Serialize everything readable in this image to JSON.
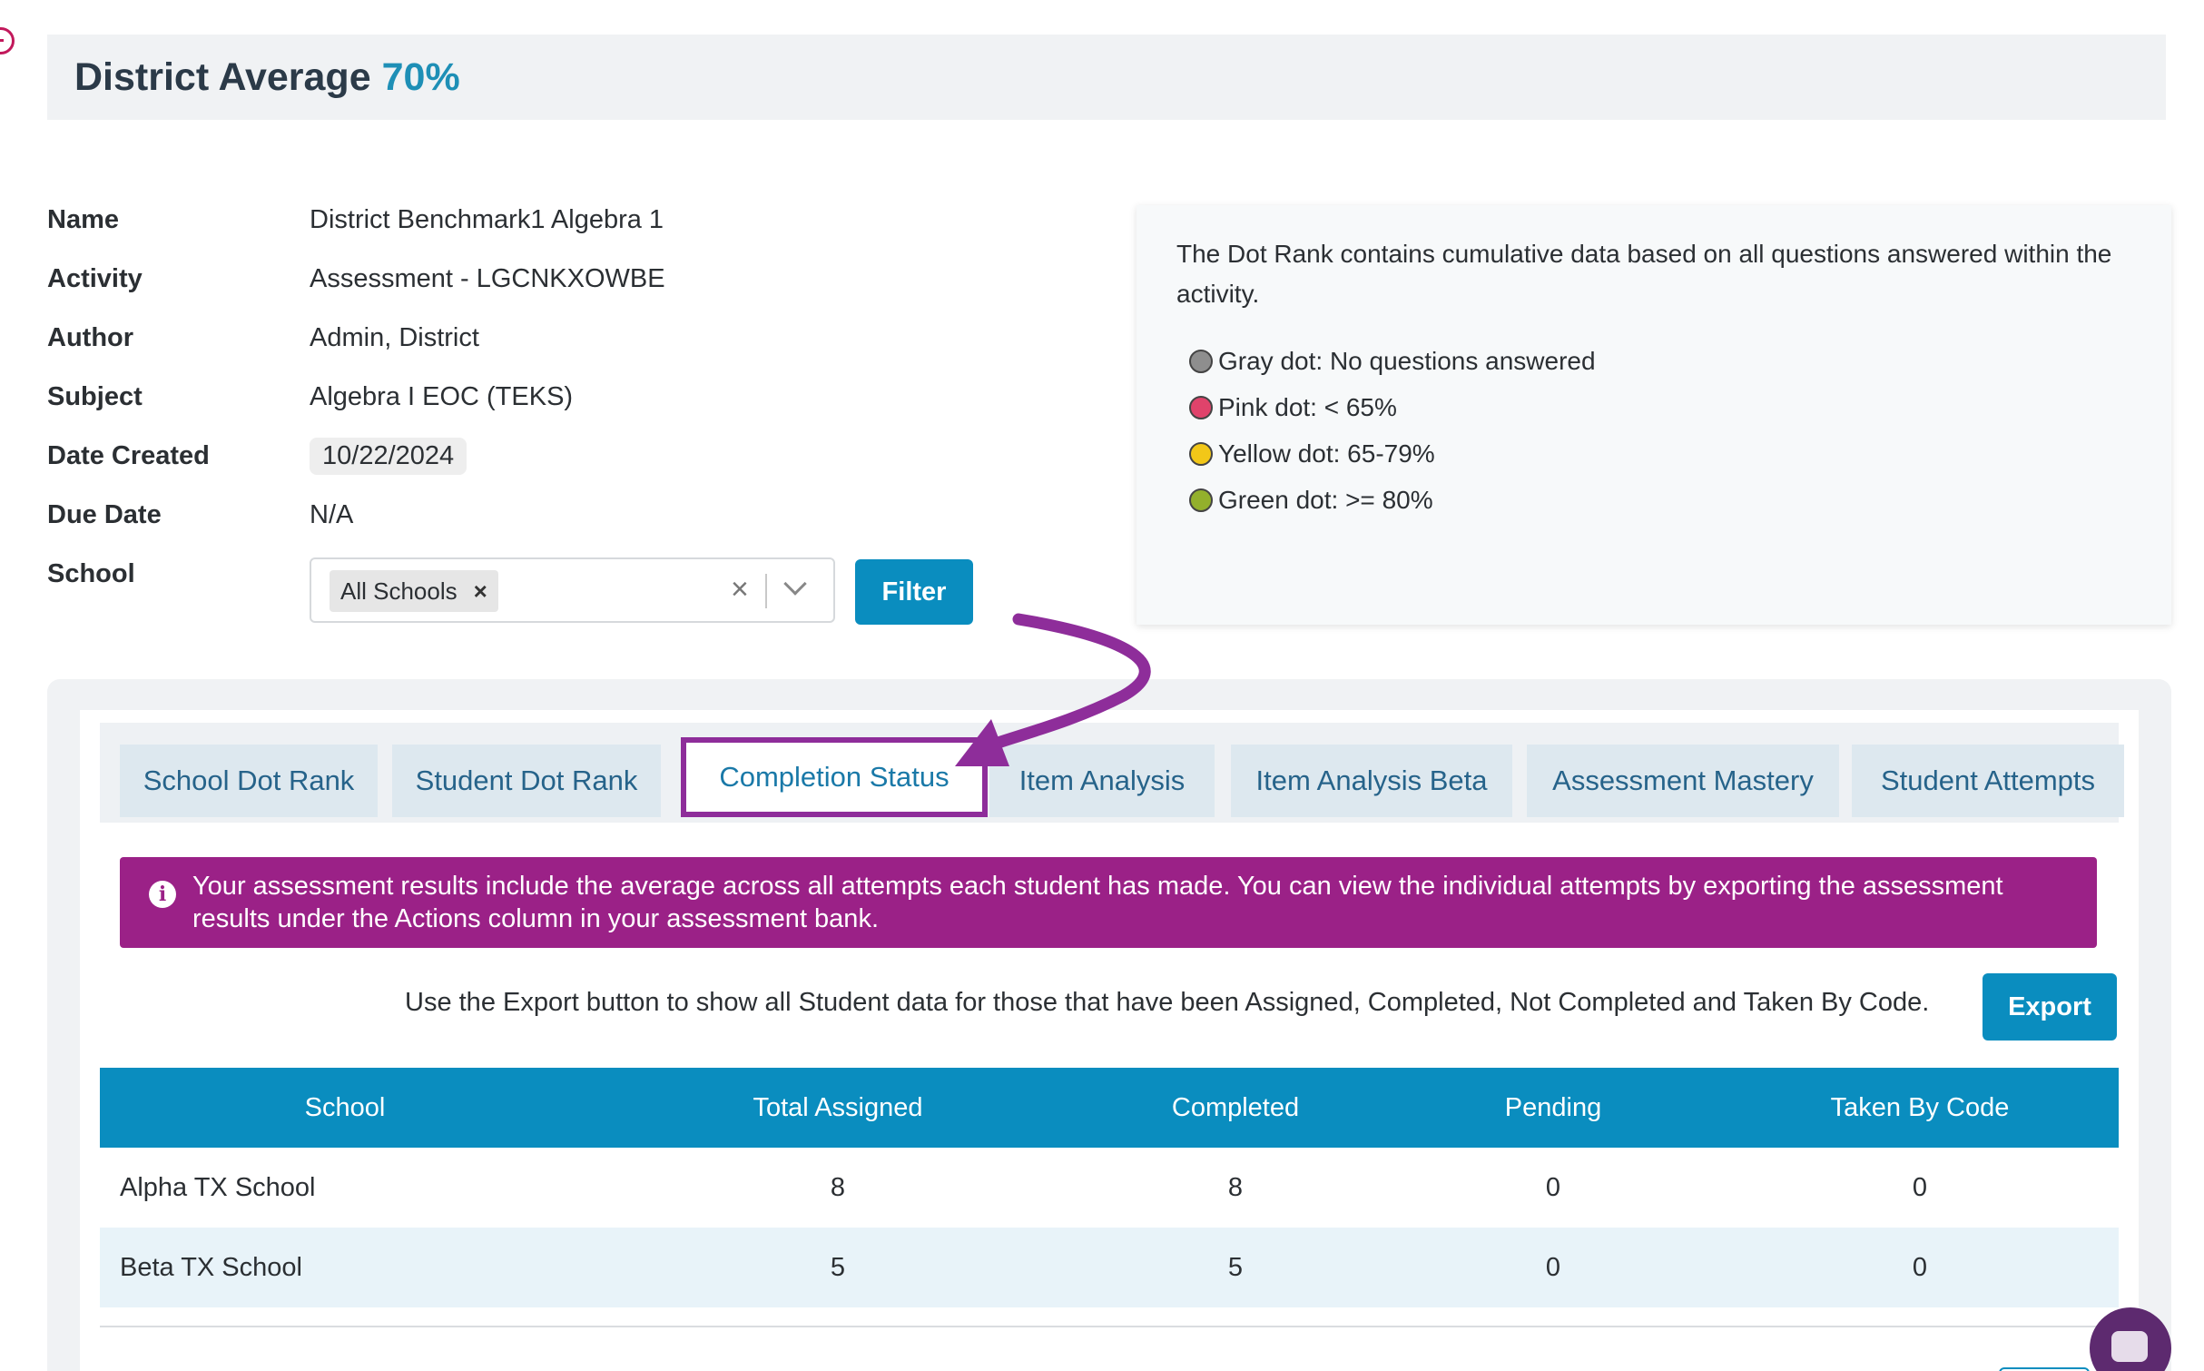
{
  "header": {
    "title": "District Average",
    "average": "70%"
  },
  "info": [
    {
      "label": "Name",
      "value": "District Benchmark1 Algebra 1"
    },
    {
      "label": "Activity",
      "value": "Assessment - LGCNKXOWBE"
    },
    {
      "label": "Author",
      "value": "Admin, District"
    },
    {
      "label": "Subject",
      "value": "Algebra I EOC (TEKS)"
    },
    {
      "label": "Date Created",
      "value": "10/22/2024"
    },
    {
      "label": "Due Date",
      "value": "N/A"
    },
    {
      "label": "School",
      "value": ""
    }
  ],
  "school_filter": {
    "chip": "All Schools",
    "chip_remove": "×",
    "clear": "×",
    "button": "Filter"
  },
  "dot_rank": {
    "intro": "The Dot Rank contains cumulative data based on all questions answered within the activity.",
    "items": [
      {
        "label": "Gray dot: No questions answered",
        "color": "#8e8e8e"
      },
      {
        "label": "Pink dot: < 65%",
        "color": "#e0436b"
      },
      {
        "label": "Yellow dot: 65-79%",
        "color": "#f2c718"
      },
      {
        "label": "Green dot: >= 80%",
        "color": "#93b02c"
      }
    ]
  },
  "tabs": [
    {
      "label": "School Dot Rank",
      "active": false
    },
    {
      "label": "Student Dot Rank",
      "active": false
    },
    {
      "label": "Completion Status",
      "active": true
    },
    {
      "label": "Item Analysis",
      "active": false
    },
    {
      "label": "Item Analysis Beta",
      "active": false
    },
    {
      "label": "Assessment Mastery",
      "active": false
    },
    {
      "label": "Student Attempts",
      "active": false
    }
  ],
  "alert": {
    "icon": "i",
    "text": "Your assessment results include the average across all attempts each student has made. You can view the individual attempts by exporting the assessment results under the Actions column in your assessment bank."
  },
  "export": {
    "text": "Use the Export button to show all Student data for those that have been Assigned, Completed, Not Completed and Taken By Code.",
    "button": "Export"
  },
  "table": {
    "columns": [
      "School",
      "Total Assigned",
      "Completed",
      "Pending",
      "Taken By Code"
    ],
    "rows": [
      [
        "Alpha TX School",
        "8",
        "8",
        "0",
        "0"
      ],
      [
        "Beta TX School",
        "5",
        "5",
        "0",
        "0"
      ]
    ]
  },
  "colors": {
    "accent": "#0a8dbf",
    "annotation": "#8e2d9a",
    "alert": "#9b2187"
  }
}
